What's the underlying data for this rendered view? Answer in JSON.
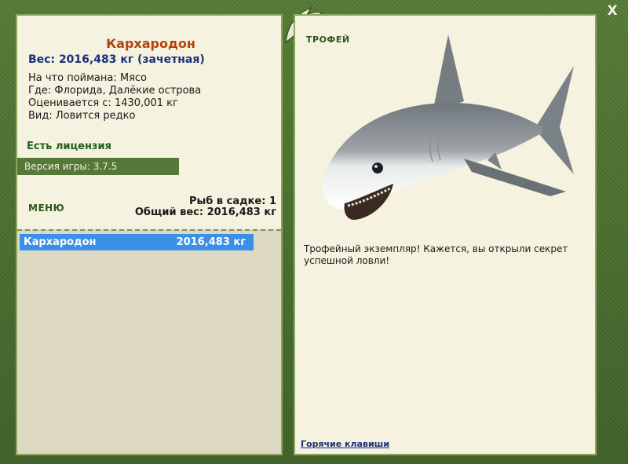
{
  "window": {
    "close_label": "X"
  },
  "fish": {
    "name": "Кархародон",
    "weight_line": "Вес: 2016,483 кг (зачетная)",
    "caught_on": "На что поймана: Мясо",
    "location": "Где: Флорида, Далёкие острова",
    "valued_from": "Оценивается с: 1430,001 кг",
    "kind": "Вид: Ловится редко"
  },
  "license_label": "Есть лицензия",
  "version_label": "Версия игры: 3.7.5",
  "menu_label": "МЕНЮ",
  "keepnet": {
    "count_line": "Рыб в садке: 1",
    "total_weight_line": "Общий вес: 2016,483 кг",
    "rows": [
      {
        "name": "Кархародон",
        "weight": "2016,483 кг"
      }
    ]
  },
  "trophy": {
    "label": "ТРОФЕЙ",
    "description": "Трофейный экземпляр! Кажется, вы открыли секрет успешной ловли!"
  },
  "hotkeys_label": "Горячие клавиши",
  "colors": {
    "frame": "#4b6e31",
    "panel": "#f5f2df",
    "selection": "#3b8fe6",
    "fish_name": "#b3420d",
    "weight_text": "#1b2f7a"
  }
}
